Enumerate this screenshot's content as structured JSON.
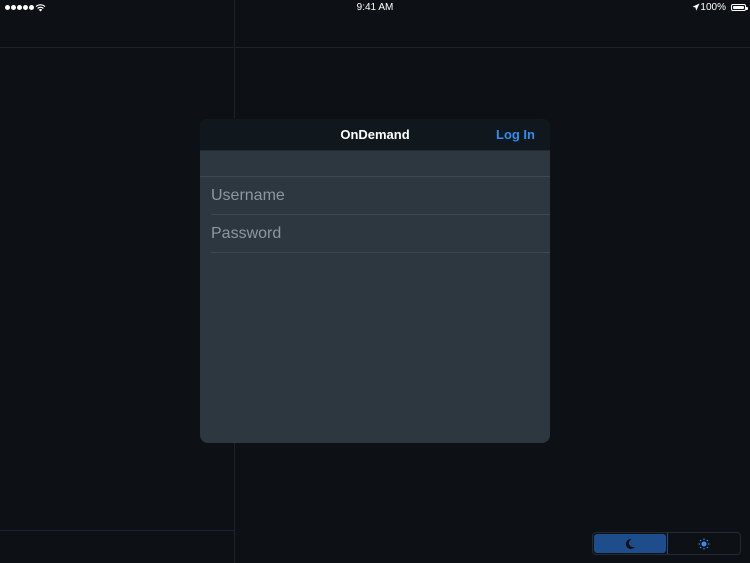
{
  "status_bar": {
    "time": "9:41 AM",
    "battery_percent": "100%",
    "signal_bars": 5,
    "signal_icon": "signal-dots-icon",
    "wifi_icon": "wifi-icon",
    "location_icon": "location-arrow-icon",
    "battery_icon": "battery-icon"
  },
  "dialog": {
    "title": "OnDemand",
    "login_label": "Log In",
    "username_placeholder": "Username",
    "password_placeholder": "Password",
    "accent_color": "#2f8ef0"
  },
  "theme_toggle": {
    "options": [
      {
        "icon": "moon-icon",
        "selected": true
      },
      {
        "icon": "sun-icon",
        "selected": false
      }
    ]
  }
}
